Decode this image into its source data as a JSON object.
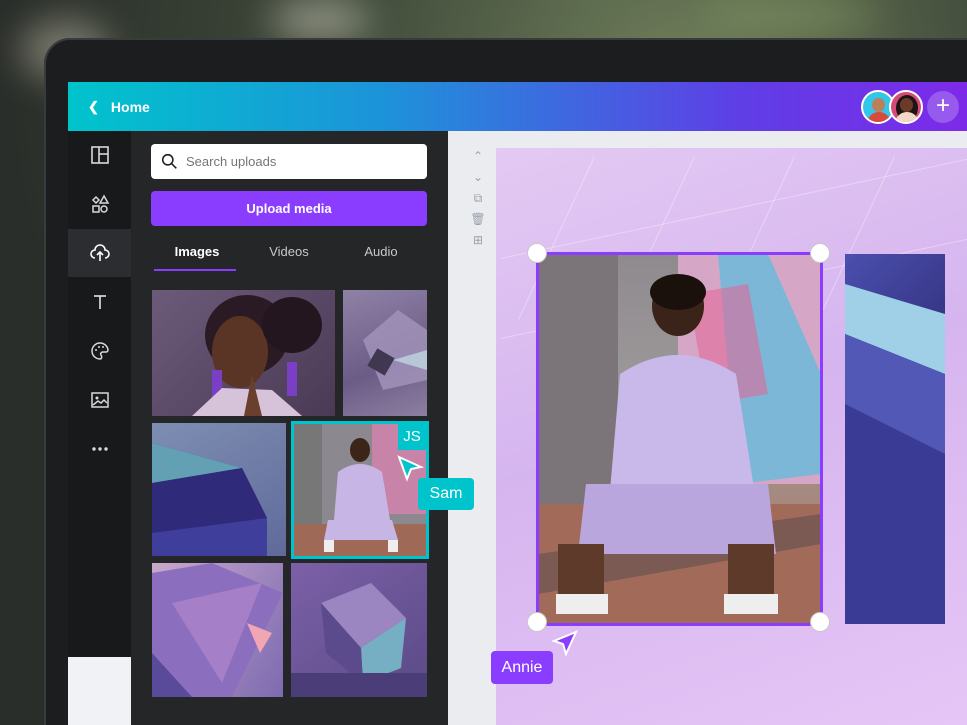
{
  "topbar": {
    "home_label": "Home"
  },
  "rail": {
    "items": [
      {
        "icon": "layout-icon"
      },
      {
        "icon": "elements-icon"
      },
      {
        "icon": "upload-cloud-icon",
        "active": true
      },
      {
        "icon": "text-icon"
      },
      {
        "icon": "palette-icon"
      },
      {
        "icon": "photo-icon"
      },
      {
        "icon": "more-icon"
      }
    ]
  },
  "panel": {
    "search_placeholder": "Search uploads",
    "upload_label": "Upload media",
    "tabs": [
      {
        "label": "Images",
        "active": true
      },
      {
        "label": "Videos"
      },
      {
        "label": "Audio"
      }
    ]
  },
  "collaborators": {
    "thumb_badge": "JS",
    "sam": "Sam",
    "annie": "Annie"
  },
  "colors": {
    "accent": "#8b3dff",
    "teal": "#00c4cc"
  }
}
